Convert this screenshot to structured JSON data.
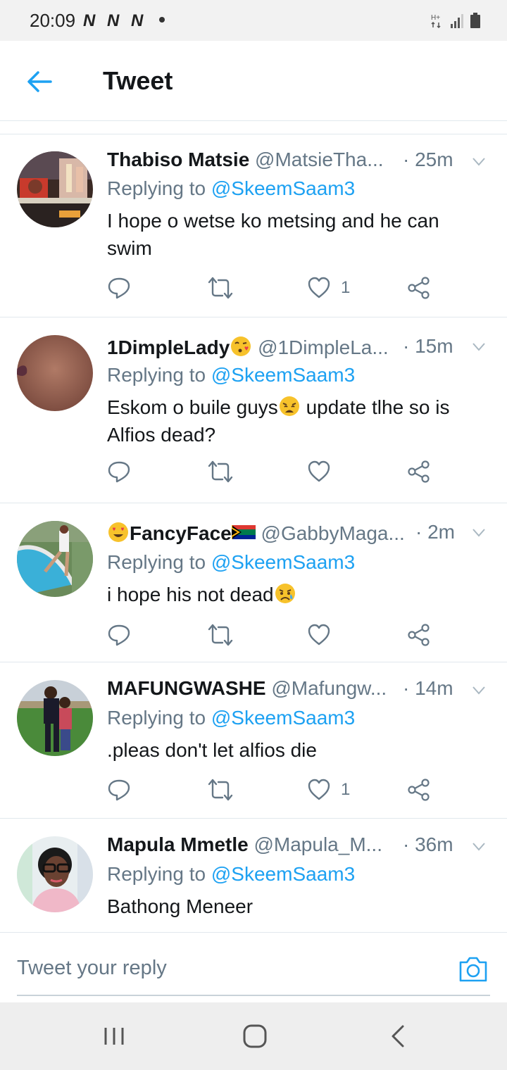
{
  "status_bar": {
    "time": "20:09",
    "notif_glyphs": [
      "N",
      "N",
      "N"
    ],
    "icons": [
      "hplus-data-icon",
      "signal-bars-icon",
      "battery-icon"
    ]
  },
  "header": {
    "back_icon": "arrow-left-icon",
    "title": "Tweet"
  },
  "tweets": [
    {
      "name": "Thabiso Matsie",
      "handle": "@MatsieTha...",
      "time": "· 25m",
      "reply_prefix": "Replying to ",
      "reply_to": "@SkeemSaam3",
      "text": "I hope o wetse ko metsing and he can swim",
      "likes": "1"
    },
    {
      "name": "1DimpleLady",
      "name_emoji": "kissing-heart-emoji",
      "handle": "@1DimpleLa...",
      "time": "· 15m",
      "reply_prefix": "Replying to ",
      "reply_to": "@SkeemSaam3",
      "text_a": "Eskom o buile guys",
      "text_emoji": "weary-face-emoji",
      "text_b": " update tlhe so is Alfios dead?",
      "likes": ""
    },
    {
      "name": "FancyFace",
      "name_emoji_before": "heart-eyes-emoji",
      "name_emoji_after": "south-africa-flag-emoji",
      "handle": "@GabbyMaga...",
      "time": "· 2m",
      "reply_prefix": "Replying to ",
      "reply_to": "@SkeemSaam3",
      "text": "i hope his not dead",
      "text_emoji": "crying-face-emoji",
      "likes": ""
    },
    {
      "name": "MAFUNGWASHE",
      "handle": "@Mafungw...",
      "time": "· 14m",
      "reply_prefix": "Replying to ",
      "reply_to": "@SkeemSaam3",
      "text": ".pleas don't let alfios die",
      "likes": "1"
    },
    {
      "name": "Mapula Mmetle",
      "handle": "@Mapula_M...",
      "time": "· 36m",
      "reply_prefix": "Replying to ",
      "reply_to": "@SkeemSaam3",
      "text": "Bathong Meneer"
    }
  ],
  "reply_box": {
    "placeholder": "Tweet your reply",
    "camera_icon": "camera-icon"
  },
  "nav_bar": {
    "icons": [
      "recent-apps-icon",
      "home-icon",
      "back-icon"
    ]
  },
  "colors": {
    "accent": "#1da1f2",
    "secondary_text": "#657786",
    "primary_text": "#14171a",
    "divider": "#e1e8ed",
    "status_bar_bg": "#f2f2f2",
    "nav_bar_bg": "#eeeeee"
  }
}
